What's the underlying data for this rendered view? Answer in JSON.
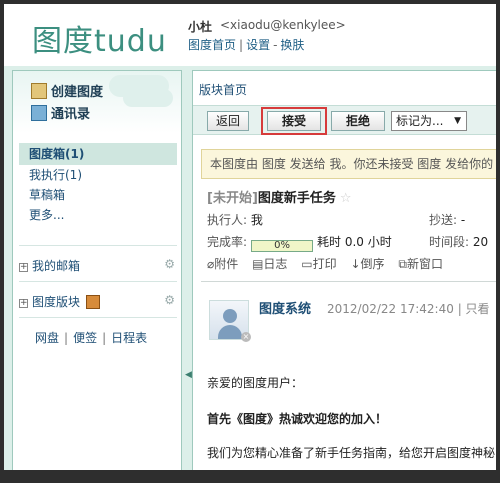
{
  "header": {
    "logo_cn": "图度",
    "logo_en": "tudu",
    "user_name": "小杜",
    "user_email": "<xiaodu@kenkylee>",
    "links": [
      "图度首页",
      "设置",
      "换肤"
    ]
  },
  "sidebar": {
    "quick": [
      "创建图度",
      "通讯录"
    ],
    "folders": {
      "inbox": "图度箱(1)",
      "todo": "我执行(1)",
      "drafts": "草稿箱",
      "more": "更多..."
    },
    "mailbox": "我的邮箱",
    "boards": "图度版块",
    "bottom_links": [
      "网盘",
      "便签",
      "日程表"
    ]
  },
  "main": {
    "breadcrumb": "版块首页",
    "toolbar": {
      "back": "返回",
      "accept": "接受",
      "reject": "拒绝",
      "mark_as": "标记为..."
    },
    "notice": "本图度由 图度 发送给 我。你还未接受 图度 发给你的",
    "task": {
      "status": "[未开始]",
      "title": "图度新手任务",
      "executor_label": "执行人:",
      "executor": "我",
      "cc_label": "抄送:",
      "cc": "-",
      "completion_label": "完成率:",
      "completion": "0%",
      "completion_fraction": 0.0,
      "time_spent": "耗时 0.0 小时",
      "time_range_label": "时间段:",
      "time_range": "20"
    },
    "actions": [
      "附件",
      "日志",
      "打印",
      "倒序",
      "新窗口"
    ],
    "post": {
      "author": "图度系统",
      "time": "2012/02/22 17:42:40 | 只看",
      "line1": "亲爱的图度用户：",
      "line2": "首先《图度》热诚欢迎您的加入！",
      "line3": "我们为您精心准备了新手任务指南，给您开启图度神秘"
    }
  }
}
